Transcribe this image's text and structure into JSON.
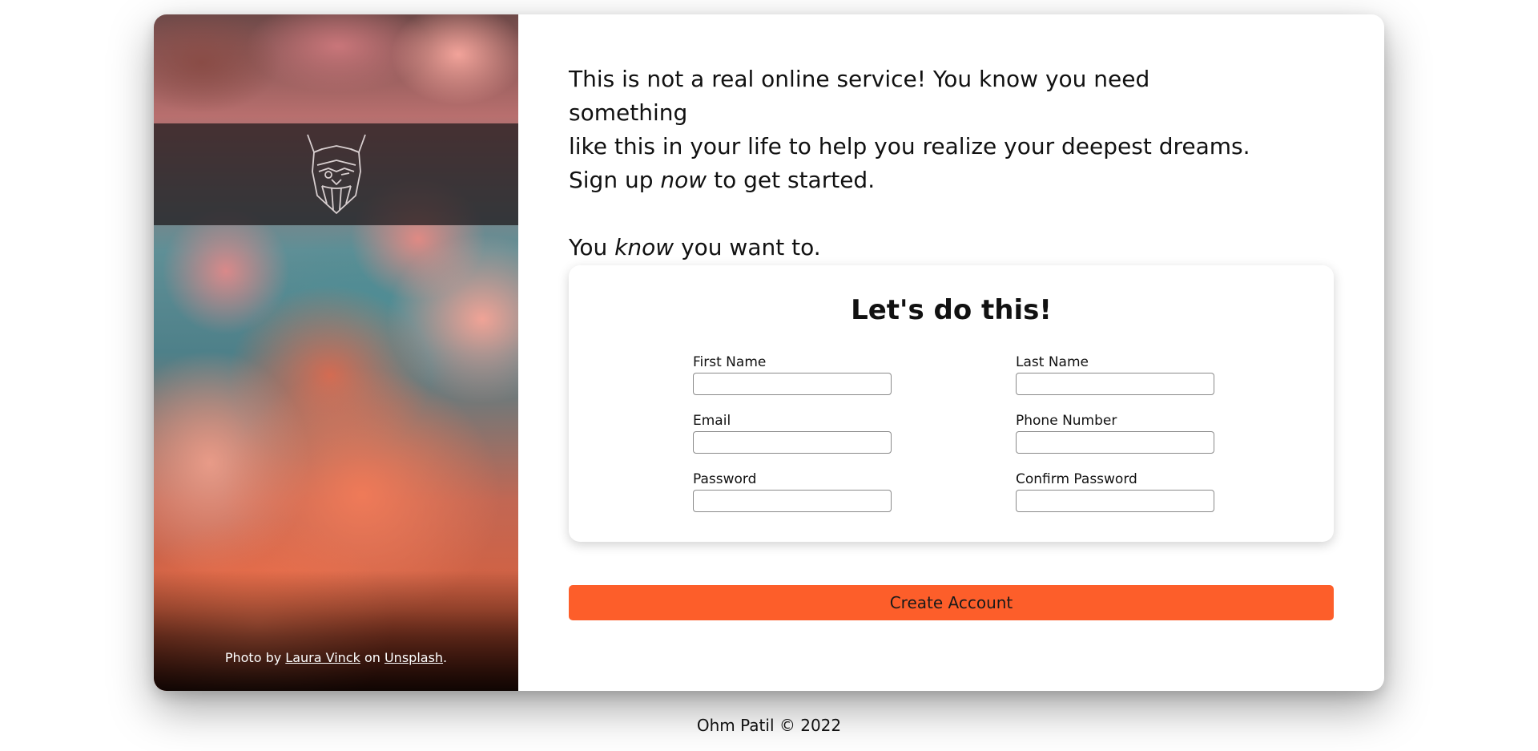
{
  "intro": {
    "line1": "This is not a real online service! You know you need something",
    "line2": "like this in your life to help you realize your deepest dreams.",
    "line3_before": "Sign up ",
    "line3_em": "now",
    "line3_after": " to get started.",
    "know_before": "You ",
    "know_em": "know",
    "know_after": " you want to."
  },
  "credit": {
    "prefix": "Photo by ",
    "author": "Laura Vinck",
    "middle": " on ",
    "site": "Unsplash",
    "suffix": "."
  },
  "form": {
    "title": "Let's do this!",
    "fields": [
      {
        "label": "First Name",
        "value": ""
      },
      {
        "label": "Last Name",
        "value": ""
      },
      {
        "label": "Email",
        "value": ""
      },
      {
        "label": "Phone Number",
        "value": ""
      },
      {
        "label": "Password",
        "value": ""
      },
      {
        "label": "Confirm Password",
        "value": ""
      }
    ],
    "submit_label": "Create Account"
  },
  "footer": {
    "text": "Ohm Patil © 2022"
  },
  "colors": {
    "accent": "#fd5e2a",
    "logo_band": "#1c181a"
  },
  "icons": {
    "logo": "viking-head-icon"
  }
}
